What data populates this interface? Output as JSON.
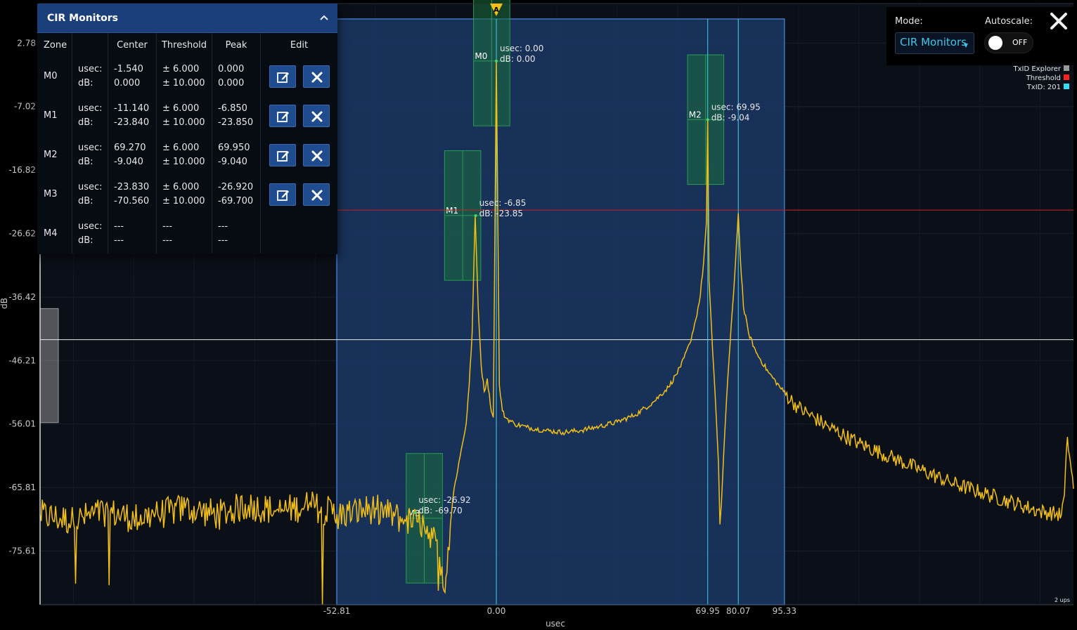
{
  "colors": {
    "background": "#000000",
    "plot_background": "#0b0f18",
    "signal": "#f2bf17",
    "threshold": "#cc2222",
    "window_fill": "#1b3a6a",
    "window_border": "#3f78c8",
    "txid_line": "#3fd0ea",
    "monitor_zone": "#1a6d3a",
    "panel_header": "#1a3f7a",
    "button": "#1f4b8f"
  },
  "chart_data": {
    "type": "line",
    "xlabel": "usec",
    "ylabel": "dB",
    "xlim": [
      -151,
      191
    ],
    "ylim": [
      -83.9,
      8.88
    ],
    "grid": true,
    "y_ticks": [
      2.78,
      -7.02,
      -16.82,
      -26.62,
      -36.42,
      -46.21,
      -56.01,
      -65.81,
      -75.61
    ],
    "y_tick_labels": [
      "2.78",
      "-7.02",
      "-16.82",
      "-26.62",
      "-36.42",
      "-46.21",
      "-56.01",
      "-65.81",
      "-75.61"
    ],
    "x_ticks": [
      -52.81,
      0.0,
      69.95,
      80.07,
      95.33
    ],
    "x_tick_labels": [
      "-52.81",
      "0.00",
      "69.95",
      "80.07",
      "95.33"
    ],
    "threshold_db": -23.0,
    "cursor_db": -43.0,
    "window": {
      "start": -52.81,
      "end": 95.33
    },
    "marker_lines": [
      0.0,
      69.95,
      80.07
    ],
    "series": [
      {
        "points": [
          [
            -151,
            -70
          ],
          [
            -140,
            -71
          ],
          [
            -130,
            -69.5
          ],
          [
            -120,
            -70.5
          ],
          [
            -112,
            -70
          ],
          [
            -103,
            -69
          ],
          [
            -92,
            -70
          ],
          [
            -82,
            -68.5
          ],
          [
            -72,
            -69.5
          ],
          [
            -62,
            -68.5
          ],
          [
            -52,
            -70
          ],
          [
            -40,
            -69
          ],
          [
            -30,
            -71
          ],
          [
            -24,
            -71.5
          ],
          [
            -20,
            -74
          ],
          [
            -18,
            -78
          ],
          [
            -17,
            -82
          ],
          [
            -16,
            -75
          ],
          [
            -14,
            -66
          ],
          [
            -12,
            -61
          ],
          [
            -10,
            -56
          ],
          [
            -9,
            -50
          ],
          [
            -8,
            -42
          ],
          [
            -7,
            -23.85
          ],
          [
            -6,
            -38
          ],
          [
            -5,
            -47
          ],
          [
            -4,
            -51
          ],
          [
            -3,
            -49
          ],
          [
            -2,
            -53
          ],
          [
            -1,
            -55
          ],
          [
            0,
            0
          ],
          [
            1,
            -50
          ],
          [
            2,
            -54
          ],
          [
            3,
            -55
          ],
          [
            6,
            -56
          ],
          [
            10,
            -56.5
          ],
          [
            16,
            -57
          ],
          [
            22,
            -57.3
          ],
          [
            28,
            -57
          ],
          [
            34,
            -56.4
          ],
          [
            40,
            -55.7
          ],
          [
            46,
            -54.6
          ],
          [
            52,
            -52.6
          ],
          [
            57,
            -50.3
          ],
          [
            61,
            -47.2
          ],
          [
            64,
            -43.6
          ],
          [
            66,
            -39.9
          ],
          [
            67.5,
            -36.2
          ],
          [
            68.6,
            -31
          ],
          [
            69.5,
            -25
          ],
          [
            69.95,
            -9.04
          ],
          [
            70.4,
            -34
          ],
          [
            71.6,
            -45
          ],
          [
            72.8,
            -55
          ],
          [
            73.5,
            -62
          ],
          [
            74,
            -71.5
          ],
          [
            74.5,
            -68
          ],
          [
            75.3,
            -60
          ],
          [
            76.2,
            -52
          ],
          [
            77.3,
            -44
          ],
          [
            78.5,
            -36
          ],
          [
            79.5,
            -28
          ],
          [
            80.07,
            -23.5
          ],
          [
            80.7,
            -30
          ],
          [
            81.8,
            -38
          ],
          [
            83.5,
            -42
          ],
          [
            86,
            -45
          ],
          [
            90,
            -48
          ],
          [
            95,
            -51
          ],
          [
            100,
            -53.5
          ],
          [
            110,
            -56.5
          ],
          [
            120,
            -59
          ],
          [
            130,
            -61
          ],
          [
            140,
            -63
          ],
          [
            150,
            -65
          ],
          [
            160,
            -66.5
          ],
          [
            170,
            -68
          ],
          [
            180,
            -69.5
          ],
          [
            187,
            -70
          ],
          [
            188,
            -67
          ],
          [
            189,
            -58
          ],
          [
            190,
            -62
          ],
          [
            191,
            -66
          ]
        ]
      }
    ],
    "monitors": [
      {
        "label": "M0",
        "center": -1.54,
        "threshold_db": 10
      },
      {
        "label": "M1",
        "center": -11.14,
        "threshold_db": 10
      },
      {
        "label": "M2",
        "center": 69.27,
        "threshold_db": 10
      },
      {
        "label": "M3",
        "center": -23.83,
        "threshold_db": 10
      }
    ],
    "zone_width_usec": 6.0,
    "peak_annotations": [
      {
        "x": 0.0,
        "y": 0.0,
        "lines": [
          "usec: 0.00",
          "dB: 0.00"
        ]
      },
      {
        "x": -6.85,
        "y": -23.85,
        "lines": [
          "usec: -6.85",
          "dB: -23.85"
        ]
      },
      {
        "x": 69.95,
        "y": -9.04,
        "lines": [
          "usec: 69.95",
          "dB: -9.04"
        ]
      },
      {
        "x": -26.92,
        "y": -69.7,
        "lines": [
          "usec: -26.92",
          "dB: -69.70"
        ]
      }
    ],
    "legend": {
      "placement": "top-right",
      "entries": [
        {
          "name": "TxID Explorer",
          "color": "#9a9a9a"
        },
        {
          "name": "Threshold",
          "color": "#ff2020"
        },
        {
          "name": "TxID: 201",
          "color": "#2ee0f0"
        }
      ]
    },
    "top_marker_glyph": "A",
    "ups_readout": "2 ups"
  },
  "panel": {
    "title": "CIR Monitors",
    "columns": [
      "Zone",
      "",
      "Center",
      "Threshold",
      "Peak",
      "Edit"
    ],
    "rows": [
      {
        "zone": "M0",
        "usec_label": "usec:",
        "db_label": "dB:",
        "center_usec": "-1.540",
        "center_db": "0.000",
        "thr_usec": "± 6.000",
        "thr_db": "± 10.000",
        "peak_usec": "0.000",
        "peak_db": "0.000",
        "editable": true
      },
      {
        "zone": "M1",
        "usec_label": "usec:",
        "db_label": "dB:",
        "center_usec": "-11.140",
        "center_db": "-23.840",
        "thr_usec": "± 6.000",
        "thr_db": "± 10.000",
        "peak_usec": "-6.850",
        "peak_db": "-23.850",
        "editable": true
      },
      {
        "zone": "M2",
        "usec_label": "usec:",
        "db_label": "dB:",
        "center_usec": "69.270",
        "center_db": "-9.040",
        "thr_usec": "± 6.000",
        "thr_db": "± 10.000",
        "peak_usec": "69.950",
        "peak_db": "-9.040",
        "editable": true
      },
      {
        "zone": "M3",
        "usec_label": "usec:",
        "db_label": "dB:",
        "center_usec": "-23.830",
        "center_db": "-70.560",
        "thr_usec": "± 6.000",
        "thr_db": "± 10.000",
        "peak_usec": "-26.920",
        "peak_db": "-69.700",
        "editable": true
      },
      {
        "zone": "M4",
        "usec_label": "usec:",
        "db_label": "dB:",
        "center_usec": "---",
        "center_db": "---",
        "thr_usec": "---",
        "thr_db": "---",
        "peak_usec": "---",
        "peak_db": "---",
        "editable": false
      }
    ],
    "icons": {
      "collapse": "chevron-up-icon",
      "edit": "edit-icon",
      "delete": "close-icon"
    }
  },
  "controls": {
    "mode_label": "Mode:",
    "mode_value": "CIR Monitors",
    "autoscale_label": "Autoscale:",
    "autoscale_state": "OFF",
    "close_icon": "close-icon"
  }
}
